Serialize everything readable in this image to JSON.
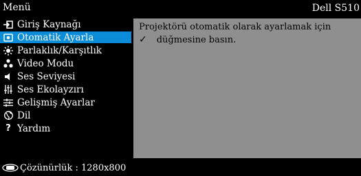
{
  "header": {
    "menu_title": "Menü",
    "model": "Dell S510"
  },
  "sidebar": {
    "items": [
      {
        "label": "Giriş Kaynağı",
        "icon": "input-source-icon",
        "selected": false
      },
      {
        "label": "Otomatik Ayarla",
        "icon": "auto-adjust-icon",
        "selected": true
      },
      {
        "label": "Parlaklık/Karşıtlık",
        "icon": "brightness-icon",
        "selected": false
      },
      {
        "label": "Video Modu",
        "icon": "video-mode-icon",
        "selected": false
      },
      {
        "label": "Ses Seviyesi",
        "icon": "volume-icon",
        "selected": false
      },
      {
        "label": "Ses Ekolayzırı",
        "icon": "equalizer-icon",
        "selected": false
      },
      {
        "label": "Gelişmiş Ayarlar",
        "icon": "advanced-settings-icon",
        "selected": false
      },
      {
        "label": "Dil",
        "icon": "language-icon",
        "selected": false
      },
      {
        "label": "Yardım",
        "icon": "help-icon",
        "selected": false
      }
    ]
  },
  "panel": {
    "line1": "Projektörü otomatik olarak ayarlamak için",
    "check_symbol": "✓",
    "line2": "düğmesine basın."
  },
  "footer": {
    "resolution_text": "Çözünürlük : 1280x800"
  },
  "colors": {
    "selected": "#0a8cd8",
    "panel": "#8f8f8f",
    "background": "#000000"
  }
}
